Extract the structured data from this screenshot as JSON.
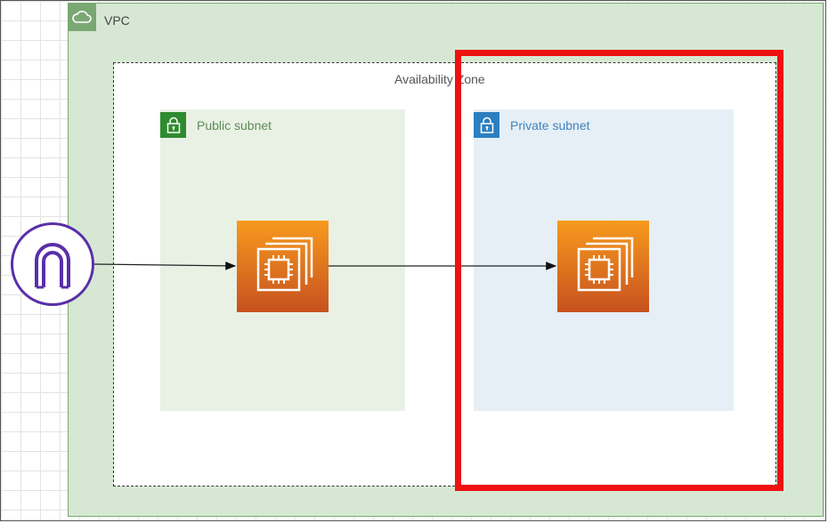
{
  "vpc": {
    "label": "VPC",
    "icon": "cloud-icon",
    "color": "#7aa873"
  },
  "availability_zone": {
    "label": "Availability Zone"
  },
  "public_subnet": {
    "label": "Public subnet",
    "icon": "lock-icon",
    "color": "#2e8b2e"
  },
  "private_subnet": {
    "label": "Private subnet",
    "icon": "lock-icon",
    "color": "#2b7fc1"
  },
  "instances": [
    {
      "icon": "ec2-instance-icon",
      "subnet": "public"
    },
    {
      "icon": "ec2-instance-icon",
      "subnet": "private"
    }
  ],
  "gateway": {
    "icon": "internet-gateway-icon",
    "color": "#5a2fa8"
  },
  "highlight": {
    "color": "#ee1111"
  }
}
